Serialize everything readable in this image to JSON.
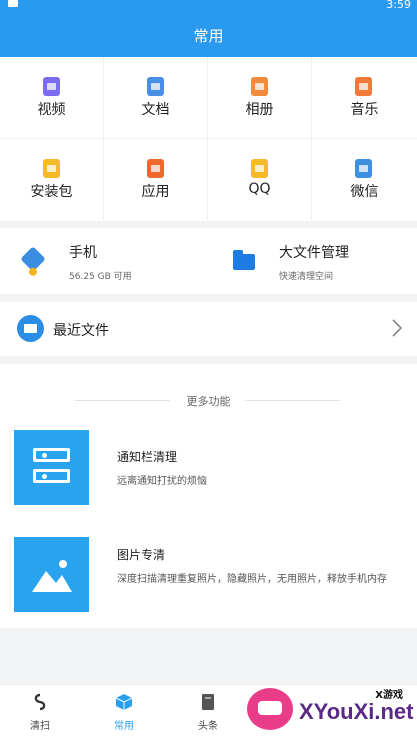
{
  "status": {
    "time": "3:59"
  },
  "header": {
    "title": "常用"
  },
  "categories": [
    {
      "label": "视频",
      "icon": "video-icon",
      "color": "#7b6cf2"
    },
    {
      "label": "文档",
      "icon": "document-icon",
      "color": "#4a8fe6"
    },
    {
      "label": "相册",
      "icon": "album-icon",
      "color": "#f08a3c"
    },
    {
      "label": "音乐",
      "icon": "music-icon",
      "color": "#f07a3a"
    },
    {
      "label": "安装包",
      "icon": "package-icon",
      "color": "#f5b92a"
    },
    {
      "label": "应用",
      "icon": "app-icon",
      "color": "#ec6a2e"
    },
    {
      "label": "QQ",
      "icon": "qq-icon",
      "color": "#f5b92a"
    },
    {
      "label": "微信",
      "icon": "wechat-icon",
      "color": "#3f8fe0"
    }
  ],
  "storage": {
    "phone": {
      "title": "手机",
      "subtitle": "56.25 GB 可用",
      "icon": "phone-storage-icon"
    },
    "bigfile": {
      "title": "大文件管理",
      "subtitle": "快速清理空间",
      "icon": "folder-icon"
    }
  },
  "recent": {
    "label": "最近文件",
    "icon": "recent-folder-icon"
  },
  "more": {
    "title": "更多功能",
    "features": [
      {
        "title": "通知栏清理",
        "desc": "远离通知打扰的烦恼",
        "icon": "notification-cleaner-icon"
      },
      {
        "title": "图片专清",
        "desc": "深度扫描清理重复照片，隐藏照片，无用照片，释放手机内存",
        "icon": "image-cleaner-icon"
      }
    ]
  },
  "nav": [
    {
      "label": "清扫",
      "icon": "sweep-icon",
      "active": false
    },
    {
      "label": "常用",
      "icon": "box-icon",
      "active": true
    },
    {
      "label": "头条",
      "icon": "news-icon",
      "active": false
    }
  ],
  "watermark": {
    "small": "X游戏",
    "text": "XYouXi.net"
  },
  "colors": {
    "accent": "#2a9af1",
    "text": "#222222",
    "muted": "#666666"
  }
}
